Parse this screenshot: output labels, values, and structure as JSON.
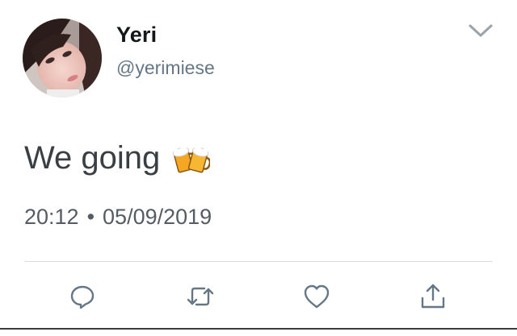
{
  "tweet": {
    "author": {
      "display_name": "Yeri",
      "handle": "@yerimiese"
    },
    "text": "We going",
    "emoji_icon": "clinking-beer-mugs-icon",
    "time": "20:12",
    "separator": "•",
    "date": "05/09/2019"
  },
  "actions": [
    "reply-icon",
    "retweet-icon",
    "like-icon",
    "share-icon"
  ],
  "colors": {
    "primary_text": "#14171a",
    "secondary_text": "#657786",
    "icon_gray": "#657786",
    "divider": "#d9dde1"
  }
}
